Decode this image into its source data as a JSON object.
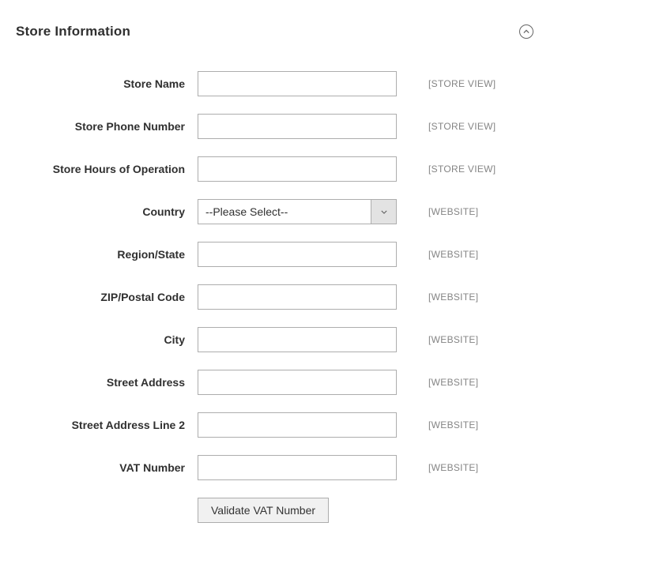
{
  "section": {
    "title": "Store Information"
  },
  "fields": {
    "storeName": {
      "label": "Store Name",
      "value": "",
      "scope": "[STORE VIEW]"
    },
    "storePhone": {
      "label": "Store Phone Number",
      "value": "",
      "scope": "[STORE VIEW]"
    },
    "storeHours": {
      "label": "Store Hours of Operation",
      "value": "",
      "scope": "[STORE VIEW]"
    },
    "country": {
      "label": "Country",
      "selected": "--Please Select--",
      "scope": "[WEBSITE]"
    },
    "region": {
      "label": "Region/State",
      "value": "",
      "scope": "[WEBSITE]"
    },
    "zip": {
      "label": "ZIP/Postal Code",
      "value": "",
      "scope": "[WEBSITE]"
    },
    "city": {
      "label": "City",
      "value": "",
      "scope": "[WEBSITE]"
    },
    "street1": {
      "label": "Street Address",
      "value": "",
      "scope": "[WEBSITE]"
    },
    "street2": {
      "label": "Street Address Line 2",
      "value": "",
      "scope": "[WEBSITE]"
    },
    "vat": {
      "label": "VAT Number",
      "value": "",
      "scope": "[WEBSITE]"
    }
  },
  "buttons": {
    "validateVat": "Validate VAT Number"
  }
}
